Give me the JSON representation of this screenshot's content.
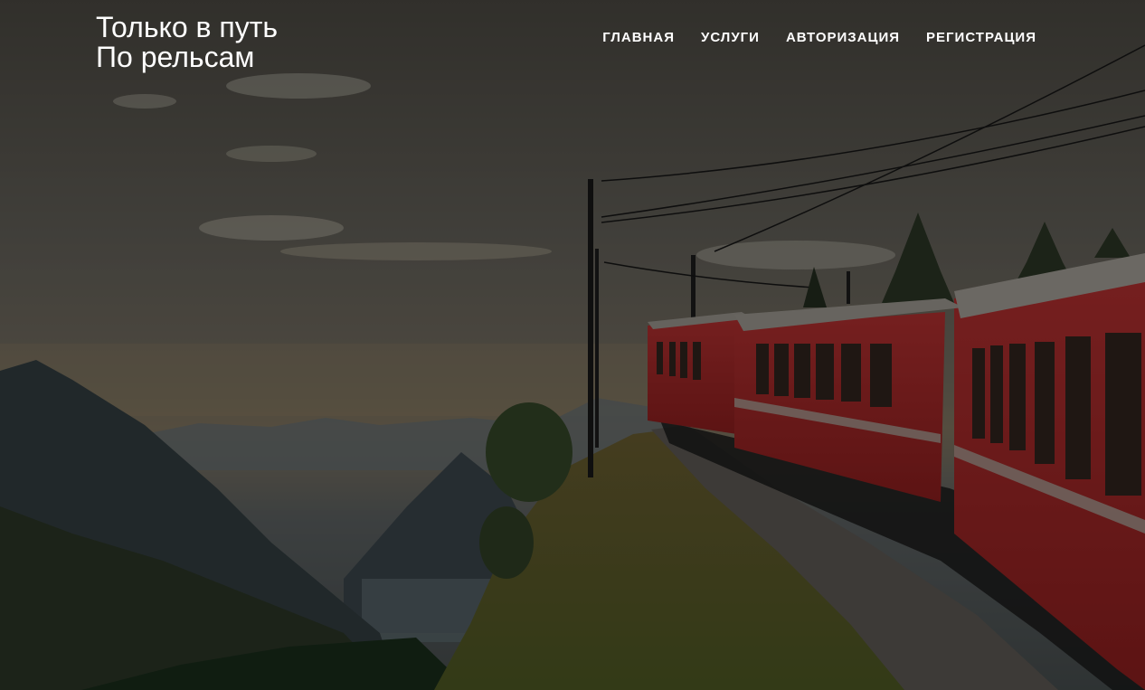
{
  "site": {
    "title_line1": "Только в путь",
    "title_line2": "По рельсам"
  },
  "nav": {
    "items": [
      {
        "label": "ГЛАВНАЯ"
      },
      {
        "label": "УСЛУГИ"
      },
      {
        "label": "АВТОРИЗАЦИЯ"
      },
      {
        "label": "РЕГИСТРАЦИЯ"
      }
    ]
  },
  "hero": {
    "image": "red-train-mountain-cliff-photo",
    "overlay_color": "#000000",
    "overlay_opacity": 0.45
  }
}
